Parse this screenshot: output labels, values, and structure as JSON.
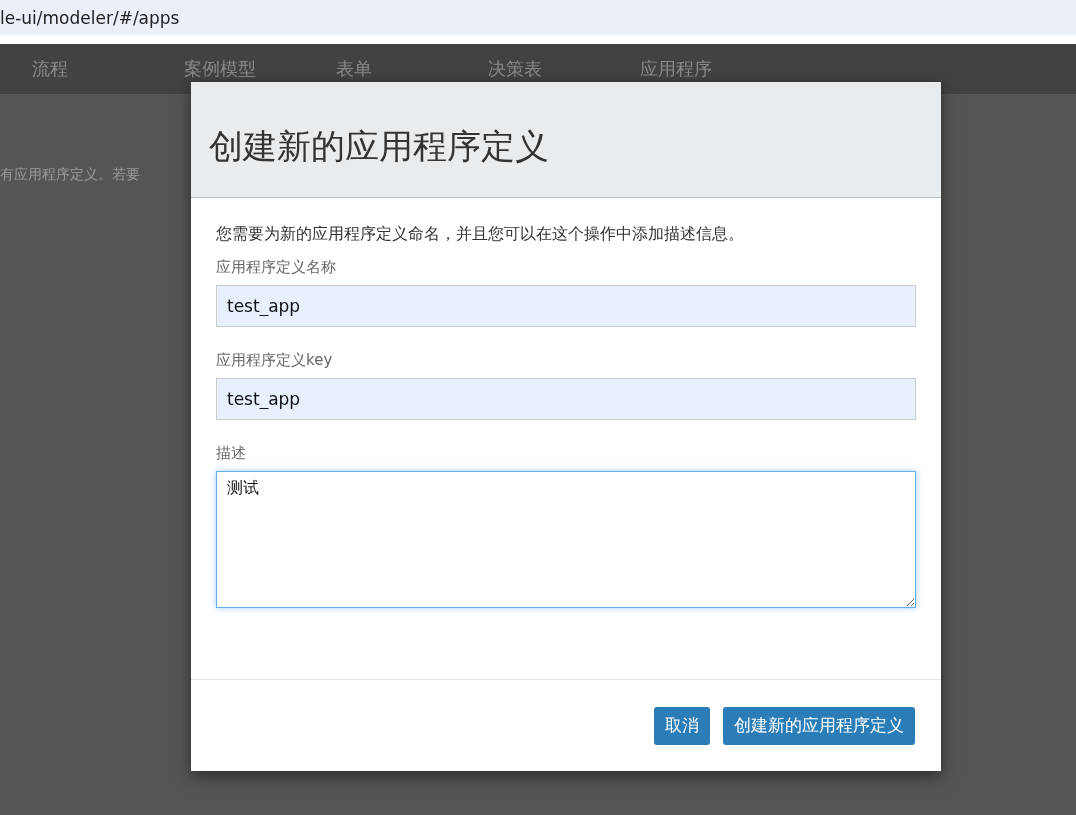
{
  "address_bar": {
    "url": "le-ui/modeler/#/apps"
  },
  "nav": {
    "items": [
      {
        "label": "流程"
      },
      {
        "label": "案例模型"
      },
      {
        "label": "表单"
      },
      {
        "label": "决策表"
      },
      {
        "label": "应用程序"
      }
    ]
  },
  "page": {
    "empty_message": "有应用程序定义。若要"
  },
  "dialog": {
    "title": "创建新的应用程序定义",
    "intro": "您需要为新的应用程序定义命名，并且您可以在这个操作中添加描述信息。",
    "fields": [
      {
        "kind": "input",
        "label": "应用程序定义名称",
        "value": "test_app",
        "focused": false
      },
      {
        "kind": "input",
        "label": "应用程序定义key",
        "value": "test_app",
        "focused": false
      },
      {
        "kind": "textarea",
        "label": "描述",
        "value": "测试",
        "focused": true
      }
    ],
    "buttons": [
      {
        "label": "取消"
      },
      {
        "label": "创建新的应用程序定义"
      }
    ]
  }
}
